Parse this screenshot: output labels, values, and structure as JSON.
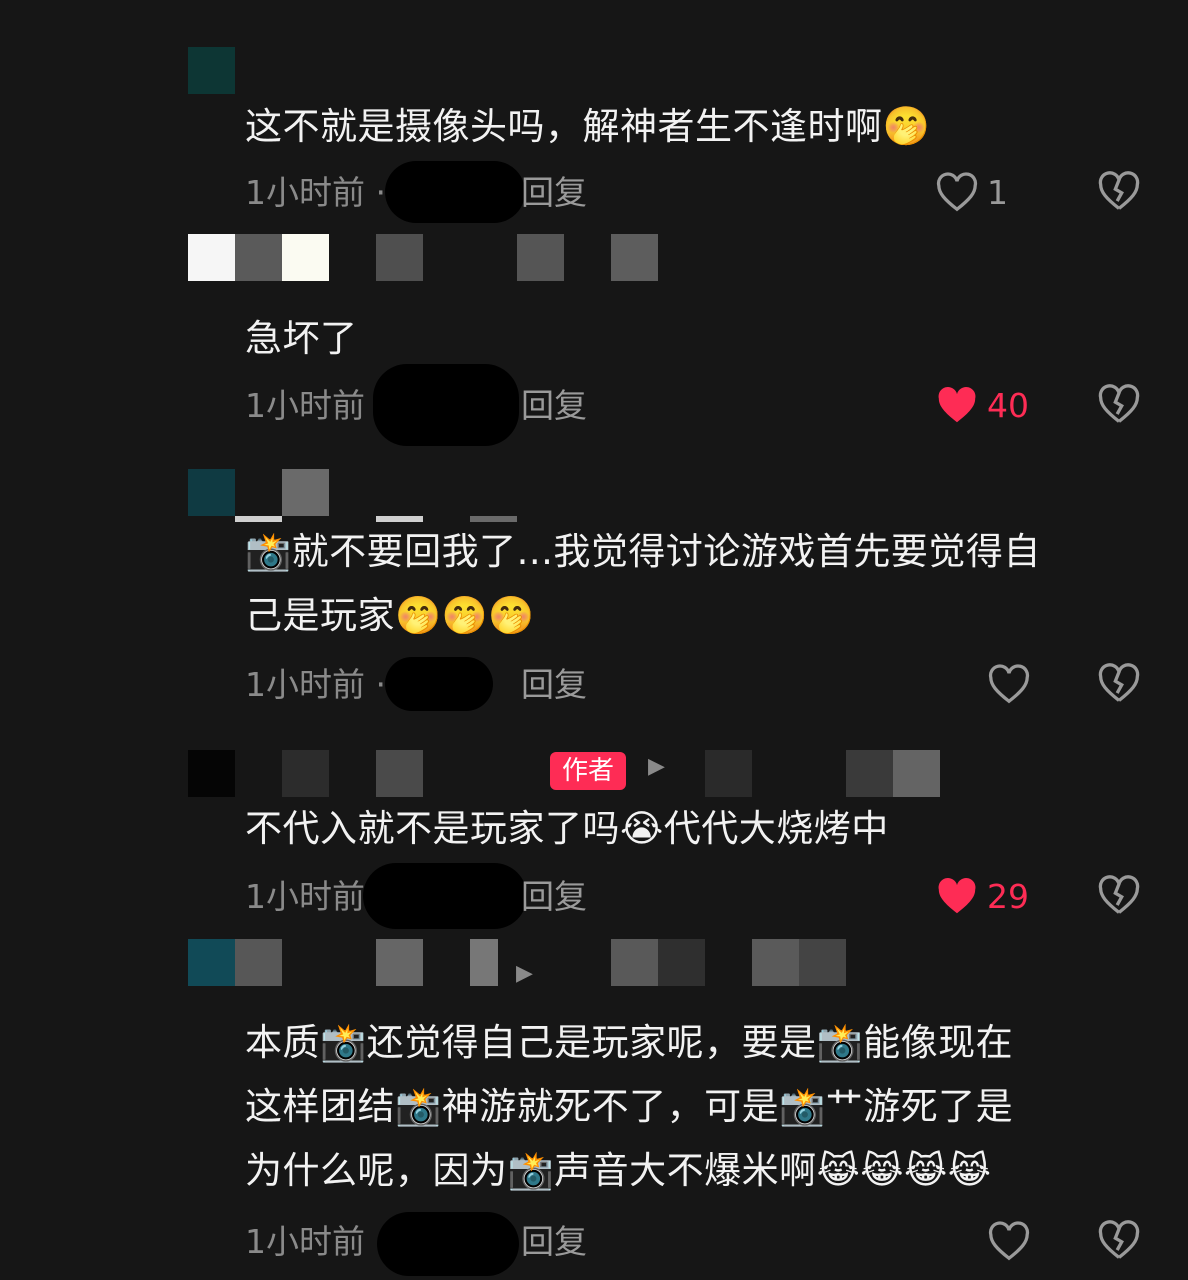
{
  "author_badge": "作者",
  "reply_label": "回复",
  "colors": {
    "background": "#161616",
    "like_active": "#fe2c55",
    "muted": "#8a8a8a"
  },
  "comments": [
    {
      "text": "这不就是摄像头吗，解神者生不逢时啊",
      "trailing_emoji": "🤭",
      "time": "1小时前 ·",
      "likes": "1",
      "liked": false
    },
    {
      "text": "急坏了",
      "time": "1小时前",
      "likes": "40",
      "liked": true
    },
    {
      "lines": [
        "📸就不要回我了...我觉得讨论游戏首先要觉得自",
        "己是玩家🤭🤭🤭"
      ],
      "time": "1小时前 ·",
      "likes": "",
      "liked": false
    },
    {
      "text": "不代入就不是玩家了吗😭代代大烧烤中",
      "time": "1小时前",
      "likes": "29",
      "liked": true
    },
    {
      "lines": [
        "本质📸还觉得自己是玩家呢，要是📸能像现在",
        "这样团结📸神游就死不了，可是📸艹游死了是",
        "为什么呢，因为📸声音大不爆米啊😹😹😹😹"
      ],
      "time": "1小时前",
      "likes": "",
      "liked": false
    }
  ],
  "icons": {
    "like": "heart-icon",
    "dislike": "broken-heart-icon",
    "play": "play-triangle-icon"
  }
}
